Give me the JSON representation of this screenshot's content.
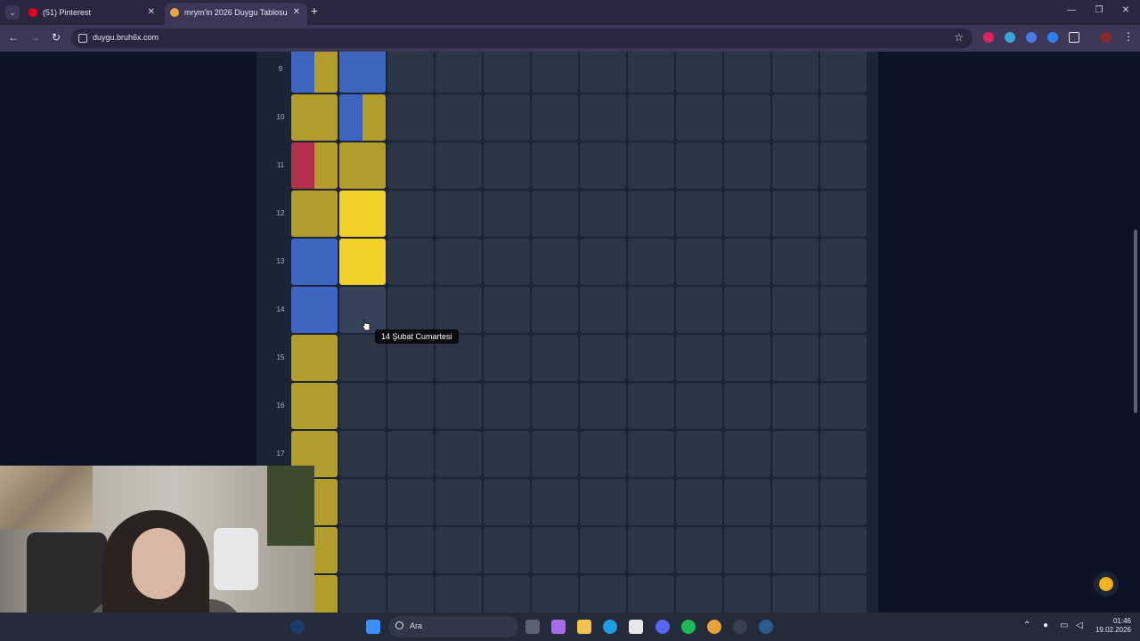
{
  "browser": {
    "tabs": [
      {
        "title": "(51) Pinterest",
        "active": false,
        "favicon_color": "#e60023"
      },
      {
        "title": "mrym'in 2026 Duygu Tablosu",
        "active": true,
        "favicon_color": "#e6a93a"
      }
    ],
    "url": "duygu.bruh6x.com"
  },
  "grid": {
    "rows": [
      {
        "label": "9",
        "cells": [
          [
            "#3e65c0",
            "#b29c2b"
          ],
          [
            "#3e65c0"
          ]
        ]
      },
      {
        "label": "10",
        "cells": [
          [
            "#b29c2b"
          ],
          [
            "#3e65c0",
            "#b29c2b"
          ]
        ]
      },
      {
        "label": "11",
        "cells": [
          [
            "#b2304a",
            "#b29c2b"
          ],
          [
            "#b29c2b"
          ]
        ]
      },
      {
        "label": "12",
        "cells": [
          [
            "#b29c2b"
          ],
          [
            "#f2d12a"
          ]
        ]
      },
      {
        "label": "13",
        "cells": [
          [
            "#3e65c0"
          ],
          [
            "#f2d12a"
          ]
        ]
      },
      {
        "label": "14",
        "cells": [
          [
            "#3e65c0"
          ],
          []
        ]
      },
      {
        "label": "15",
        "cells": [
          [
            "#b29c2b"
          ],
          []
        ]
      },
      {
        "label": "16",
        "cells": [
          [
            "#b29c2b"
          ],
          []
        ]
      },
      {
        "label": "17",
        "cells": [
          [
            "#b29c2b"
          ],
          []
        ]
      },
      {
        "label": "",
        "cells": [
          [
            "#b29c2b"
          ],
          []
        ]
      },
      {
        "label": "",
        "cells": [
          [
            "#b29c2b"
          ],
          []
        ]
      },
      {
        "label": "",
        "cells": [
          [
            "#b29c2b"
          ],
          []
        ]
      }
    ],
    "columns": 12
  },
  "tooltip": "14 Şubat Cumartesi",
  "taskbar": {
    "search_placeholder": "Ara",
    "time": "01:46",
    "date": "19.02.2026"
  }
}
